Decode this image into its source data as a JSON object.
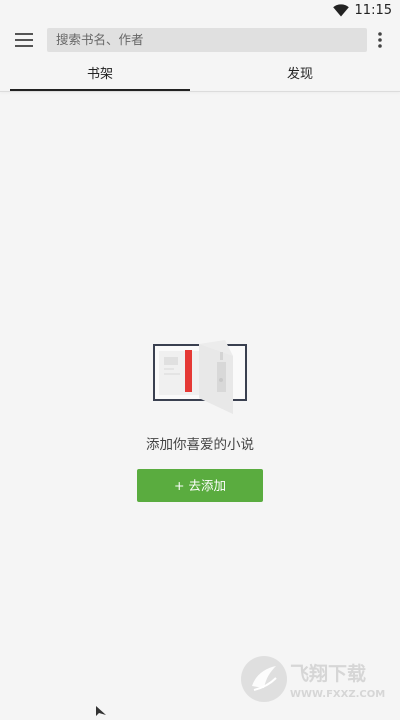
{
  "status_bar": {
    "time": "11:15",
    "icons": [
      "wifi-icon"
    ]
  },
  "toolbar": {
    "menu_icon": "hamburger-menu-icon",
    "search_placeholder": "搜索书名、作者",
    "more_icon": "more-vertical-icon"
  },
  "tabs": [
    {
      "label": "书架",
      "active": true
    },
    {
      "label": "发现",
      "active": false
    }
  ],
  "empty_state": {
    "illustration": "open-book-icon",
    "message": "添加你喜爱的小说",
    "button_label": "+ 去添加"
  },
  "watermark": {
    "title": "飞翔下载",
    "url": "WWW.FXXZ.COM"
  },
  "colors": {
    "background": "#f5f5f5",
    "search_bg": "#e0e0e0",
    "accent_green": "#5aac3f",
    "tab_indicator": "#222222",
    "bookmark_red": "#e53935"
  }
}
